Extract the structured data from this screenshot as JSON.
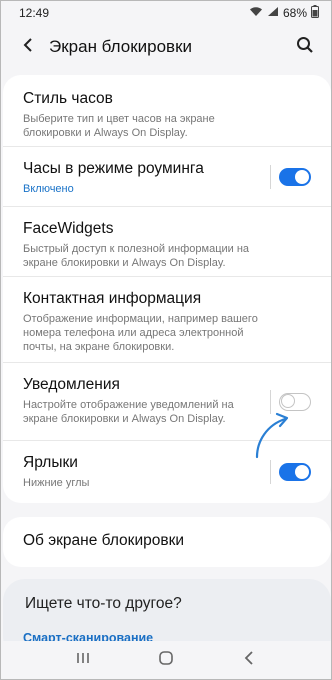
{
  "status_bar": {
    "time": "12:49",
    "battery": "68%"
  },
  "header": {
    "title": "Экран блокировки",
    "back_icon": "back-arrow-icon",
    "search_icon": "search-icon"
  },
  "settings": [
    {
      "title": "Стиль часов",
      "desc": "Выберите тип и цвет часов на экране блокировки и Always On Display.",
      "toggle": null
    },
    {
      "title": "Часы в режиме роуминга",
      "state": "Включено",
      "toggle": true
    },
    {
      "title": "FaceWidgets",
      "desc": "Быстрый доступ к полезной информации на экране блокировки и Always On Display.",
      "toggle": null
    },
    {
      "title": "Контактная информация",
      "desc": "Отображение информации, например вашего номера телефона или адреса электронной почты, на экране блокировки.",
      "toggle": null
    },
    {
      "title": "Уведомления",
      "desc": "Настройте отображение уведомлений на экране блокировки и Always On Display.",
      "toggle": false
    },
    {
      "title": "Ярлыки",
      "desc": "Нижние углы",
      "toggle": true
    }
  ],
  "about": {
    "title": "Об экране блокировки"
  },
  "more": {
    "title": "Ищете что-то другое?",
    "link": "Смарт-сканирование"
  },
  "colors": {
    "accent": "#1a73e8",
    "link": "#1a6fc4",
    "background": "#f5f5f7"
  }
}
